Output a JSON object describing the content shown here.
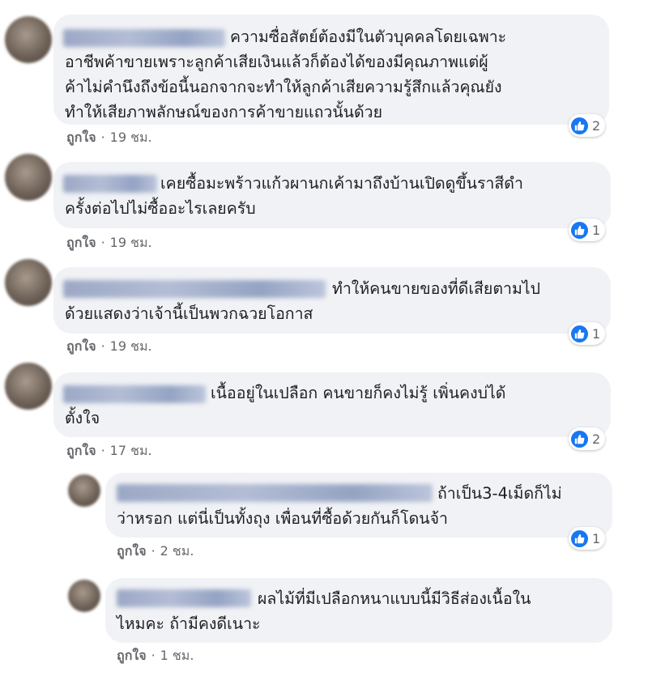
{
  "like_label": "ถูกใจ",
  "dot": "·",
  "colors": {
    "like_blue": "#1877f2",
    "bubble_bg": "#f0f2f5",
    "meta_gray": "#65676b"
  },
  "icons": {
    "reaction": "thumbs-up-icon"
  },
  "comments": [
    {
      "lines": [
        "ความซื่อสัตย์ต้องมีในตัวบุคคลโดยเฉพาะ",
        "อาชีพค้าขายเพราะลูกค้าเสียเงินแล้วก็ต้องได้ของมีคุณภาพแต่ผู้",
        "ค้าไม่คำนึงถึงข้อนี้นอกจากจะทำให้ลูกค้าเสียความรู้สึกแล้วคุณยัง",
        "ทำให้เสียภาพลักษณ์ของการค้าขายแถวนั้นด้วย"
      ],
      "reactions": "2",
      "time": "19 ชม."
    },
    {
      "lines": [
        "เคยซื้อมะพร้าวแก้วผานกเค้ามาถึงบ้านเปิดดูขึ้นราสีดำ",
        "ครั้งต่อไปไม่ซื้ออะไรเลยครับ"
      ],
      "reactions": "1",
      "time": "19 ชม."
    },
    {
      "lines": [
        "ทำให้คนขายของที่ดีเสียตามไป",
        "ด้วยแสดงว่าเจ้านี้เป็นพวกฉวยโอกาส"
      ],
      "reactions": "1",
      "time": "19 ชม."
    },
    {
      "lines": [
        "เนื้ออยู่ในเปลือก คนขายก็คงไม่รู้ เพิ่นคงบ่ได้",
        "ตั้งใจ"
      ],
      "reactions": "2",
      "time": "17 ชม."
    },
    {
      "lines": [
        "ถ้าเป็น3-4เม็ดก็ไม่",
        "ว่าหรอก แต่นี่เป็นทั้งถุง เพื่อนที่ซื้อด้วยกันก็โดนจ้า"
      ],
      "reactions": "1",
      "time": "2 ชม."
    },
    {
      "lines": [
        "ผลไม้ที่มีเปลือกหนาแบบนี้มีวิธีส่องเนื้อใน",
        "ไหมคะ ถ้ามีคงดีเนาะ"
      ],
      "reactions": null,
      "time": "1 ชม."
    }
  ]
}
